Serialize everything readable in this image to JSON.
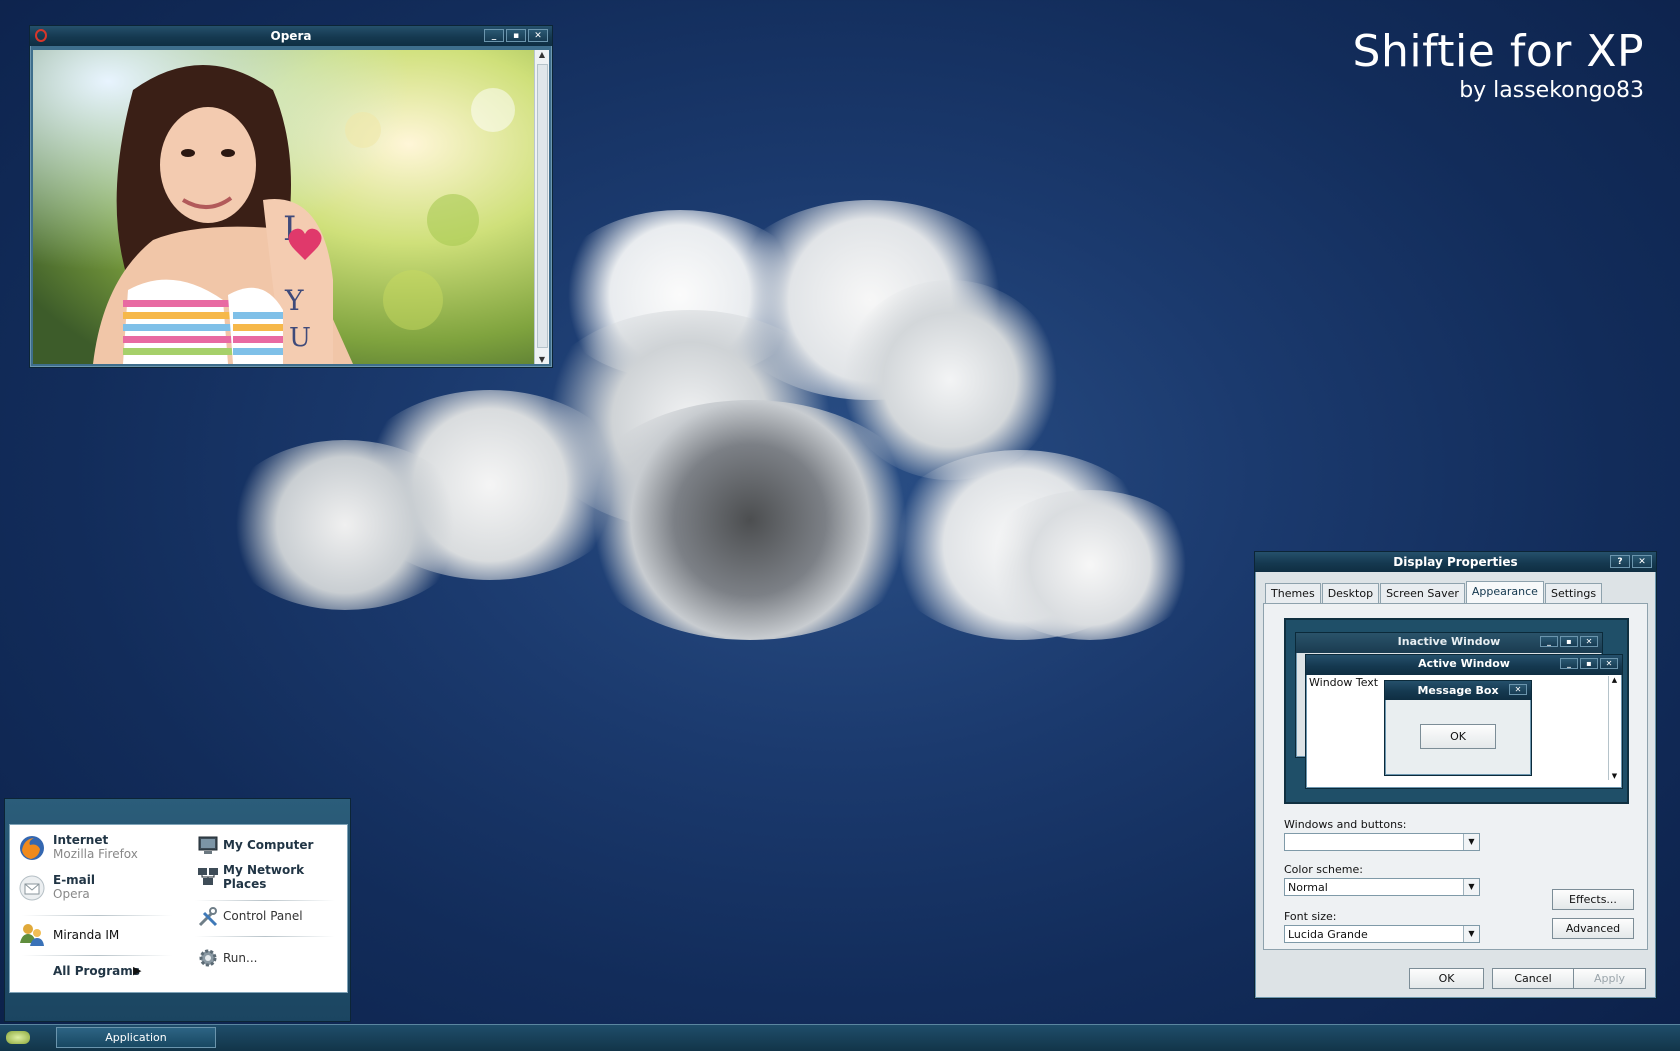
{
  "branding": {
    "title": "Shiftie for XP",
    "subtitle": "by lassekongo83"
  },
  "opera_window": {
    "title": "Opera",
    "buttons": [
      "_",
      "▪",
      "✕"
    ]
  },
  "display_properties": {
    "title": "Display Properties",
    "help": "?",
    "close": "✕",
    "tabs": [
      "Themes",
      "Desktop",
      "Screen Saver",
      "Appearance",
      "Settings"
    ],
    "active_tab": "Appearance",
    "preview": {
      "inactive_title": "Inactive Window",
      "active_title": "Active Window",
      "window_text": "Window Text",
      "message_title": "Message Box",
      "message_ok": "OK"
    },
    "windows_buttons_label": "Windows and buttons:",
    "windows_buttons_value": "",
    "color_scheme_label": "Color scheme:",
    "color_scheme_value": "Normal",
    "font_size_label": "Font size:",
    "font_size_value": "Lucida Grande",
    "effects": "Effects...",
    "advanced": "Advanced",
    "ok": "OK",
    "cancel": "Cancel",
    "apply": "Apply"
  },
  "start_menu": {
    "left": [
      {
        "title": "Internet",
        "sub": "Mozilla Firefox",
        "icon": "firefox-icon"
      },
      {
        "title": "E-mail",
        "sub": "Opera",
        "icon": "email-icon"
      },
      {
        "title": "Miranda IM",
        "sub": "",
        "icon": "users-icon"
      }
    ],
    "all_programs": "All Programs",
    "right": [
      {
        "label": "My Computer",
        "icon": "computer-icon"
      },
      {
        "label": "My Network Places",
        "icon": "network-icon"
      },
      {
        "label": "Control Panel",
        "icon": "tools-icon"
      },
      {
        "label": "Run...",
        "icon": "gear-icon"
      }
    ]
  },
  "taskbar": {
    "item": "Application"
  }
}
